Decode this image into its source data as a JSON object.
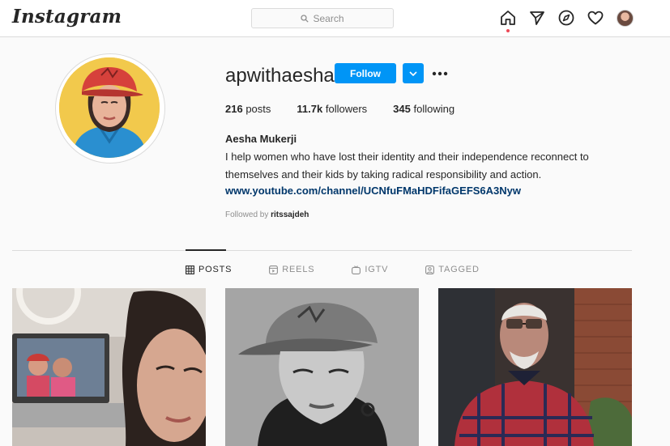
{
  "app": {
    "logo": "Instagram"
  },
  "search": {
    "placeholder": "Search"
  },
  "nav": {
    "icons": [
      "home-icon",
      "direct-message-icon",
      "explore-icon",
      "activity-heart-icon",
      "profile-avatar"
    ],
    "active": "home"
  },
  "profile": {
    "username": "apwithaesha",
    "follow_label": "Follow",
    "stats": {
      "posts_count": "216",
      "posts_label": "posts",
      "followers_count": "11.7k",
      "followers_label": "followers",
      "following_count": "345",
      "following_label": "following"
    },
    "full_name": "Aesha Mukerji",
    "bio_line1": "I help women who have lost their identity and their independence reconnect to",
    "bio_line2": "themselves and their kids by taking radical responsibility and action.",
    "link": "www.youtube.com/channel/UCNfuFMaHDFifaGEFS6A3Nyw",
    "followed_by_prefix": "Followed by",
    "followed_by_user": "ritssajdeh"
  },
  "tabs": [
    {
      "label": "POSTS",
      "icon": "grid-icon",
      "active": true
    },
    {
      "label": "REELS",
      "icon": "reels-icon",
      "active": false
    },
    {
      "label": "IGTV",
      "icon": "igtv-icon",
      "active": false
    },
    {
      "label": "TAGGED",
      "icon": "tagged-icon",
      "active": false
    }
  ],
  "colors": {
    "accent": "#0095f6",
    "link": "#00376b",
    "notification_dot": "#ed4956",
    "background": "#fafafa"
  }
}
